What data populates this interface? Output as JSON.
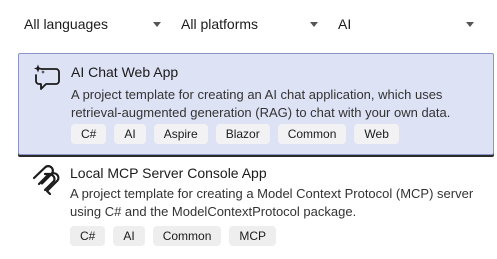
{
  "filters": {
    "language": "All languages",
    "platform": "All platforms",
    "project_type": "AI"
  },
  "templates": [
    {
      "title": "AI Chat Web App",
      "description": "A project template for creating an AI chat application, which uses retrieval-augmented generation (RAG) to chat with your own data.",
      "tags": [
        "C#",
        "AI",
        "Aspire",
        "Blazor",
        "Common",
        "Web"
      ],
      "icon": "chat-sparkle-icon",
      "selected": true
    },
    {
      "title": "Local MCP Server Console App",
      "description": "A project template for creating a Model Context Protocol (MCP) server using C# and the ModelContextProtocol package.",
      "tags": [
        "C#",
        "AI",
        "Common",
        "MCP"
      ],
      "icon": "mcp-logo-icon",
      "selected": false
    }
  ],
  "colors": {
    "selected_background": "#dde2f5",
    "selected_border": "#8a96c8",
    "tag_background": "#eeeeee"
  }
}
